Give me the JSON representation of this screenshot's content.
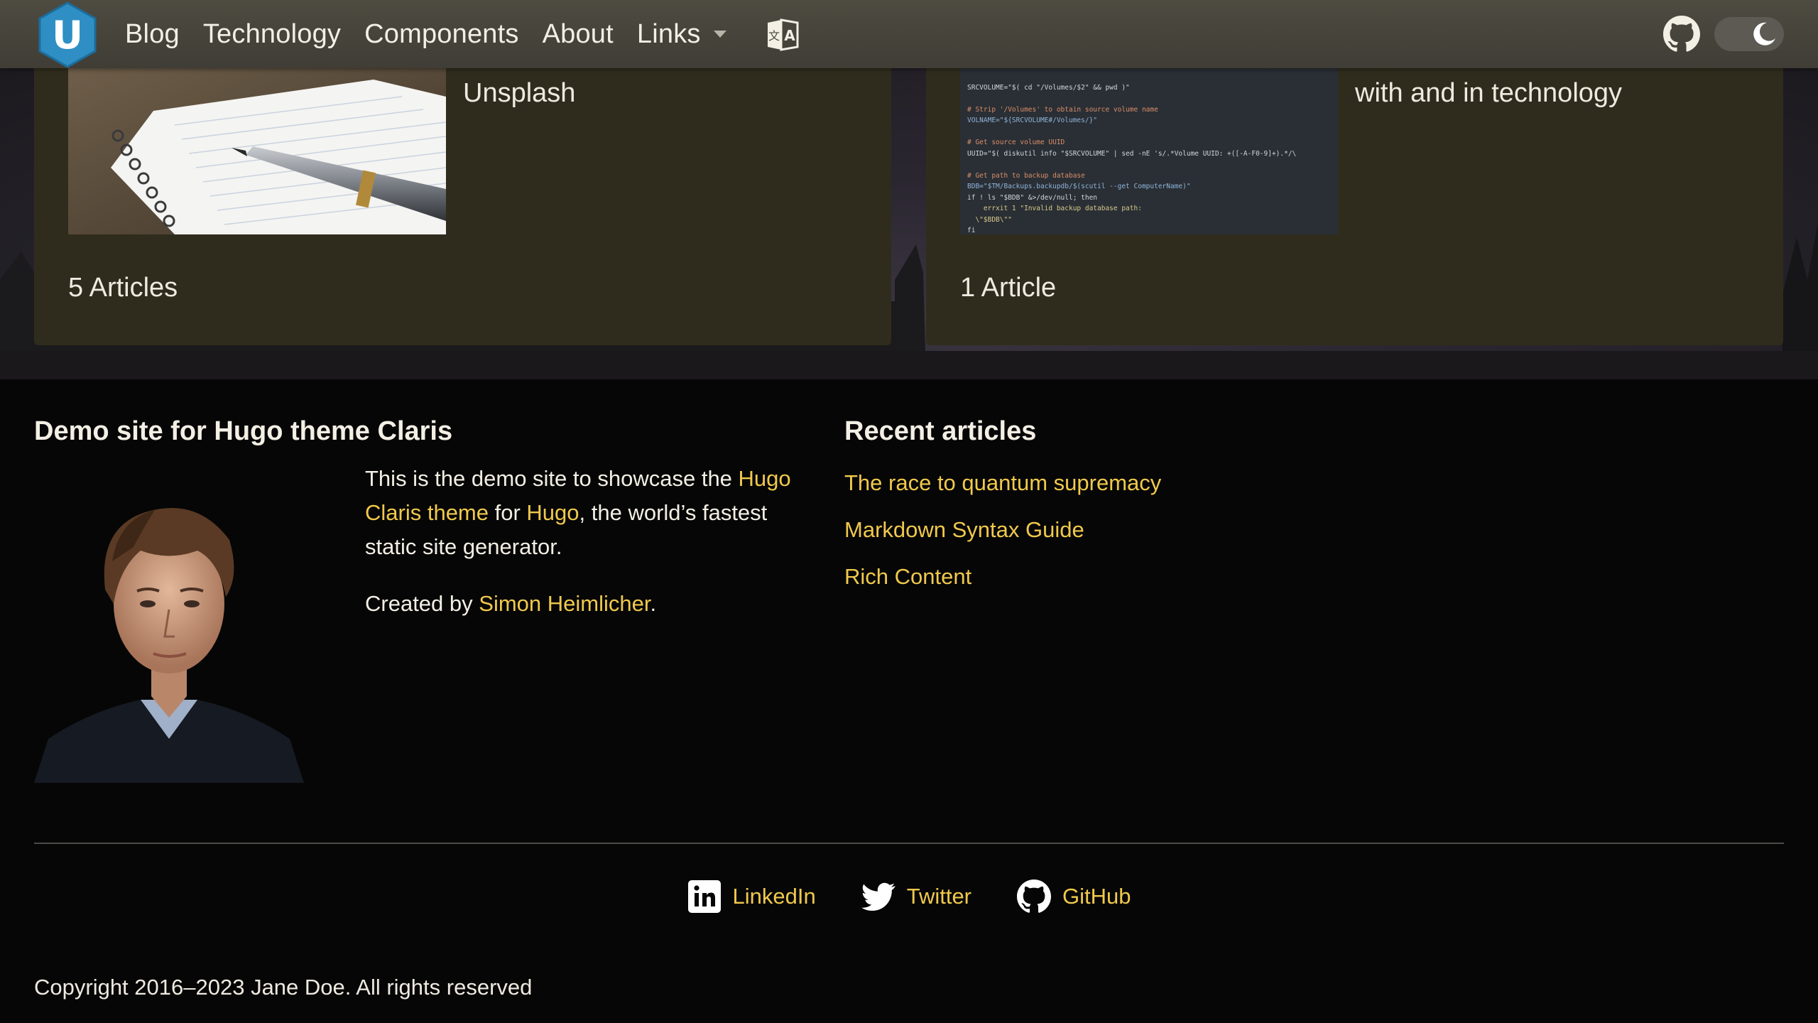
{
  "nav": {
    "logo_letter": "U",
    "items": [
      {
        "label": "Blog"
      },
      {
        "label": "Technology"
      },
      {
        "label": "Components"
      },
      {
        "label": "About"
      },
      {
        "label": "Links",
        "has_dropdown": true
      }
    ],
    "icons": {
      "language": "translate-icon",
      "github": "github-icon",
      "theme": "moon-icon"
    }
  },
  "cards": [
    {
      "caption": "Unsplash",
      "count": "5 Articles",
      "image": "notebook-with-fountain-pen"
    },
    {
      "caption": "with and in technology",
      "count": "1 Article",
      "image": "code-screenshot"
    }
  ],
  "code_lines": [
    "SRCVOLUME=\"$( cd \"/Volumes/$2\" && pwd )\"",
    "",
    "# Strip '/Volumes' to obtain source volume name",
    "VOLNAME=\"${SRCVOLUME#/Volumes/}\"",
    "",
    "# Get source volume UUID",
    "UUID=\"$( diskutil info \"$SRCVOLUME\" | sed -nE 's/.*Volume UUID: +([-A-F0-9]+).*/\\",
    "",
    "# Get path to backup database",
    "BDB=\"$TM/Backups.backupdb/$(scutil --get ComputerName)\"",
    "if ! ls \"$BDB\" &>/dev/null; then",
    "    errxit 1 \"Invalid backup database path:",
    "  \\\"$BDB\\\"\"",
    "fi"
  ],
  "footer": {
    "about_title": "Demo site for Hugo theme Claris",
    "about_p1_a": "This is the demo site to showcase the ",
    "about_p1_link1": "Hugo Claris theme",
    "about_p1_b": " for ",
    "about_p1_link2": "Hugo",
    "about_p1_c": ", the world’s fastest static site generator.",
    "about_p2_a": "Created by ",
    "about_p2_link": "Simon Heimlicher",
    "about_p2_b": ".",
    "recent_title": "Recent articles",
    "recent": [
      "The race to quantum supremacy",
      "Markdown Syntax Guide",
      "Rich Content"
    ],
    "social": [
      {
        "label": "LinkedIn",
        "icon": "linkedin-icon"
      },
      {
        "label": "Twitter",
        "icon": "twitter-icon"
      },
      {
        "label": "GitHub",
        "icon": "github-icon"
      }
    ],
    "copyright": "Copyright 2016–2023 Jane Doe. All rights reserved"
  },
  "colors": {
    "accent": "#f0c94c",
    "card": "#302c1d",
    "topbar": "#4b483f",
    "logo": "#2f8fc4"
  }
}
